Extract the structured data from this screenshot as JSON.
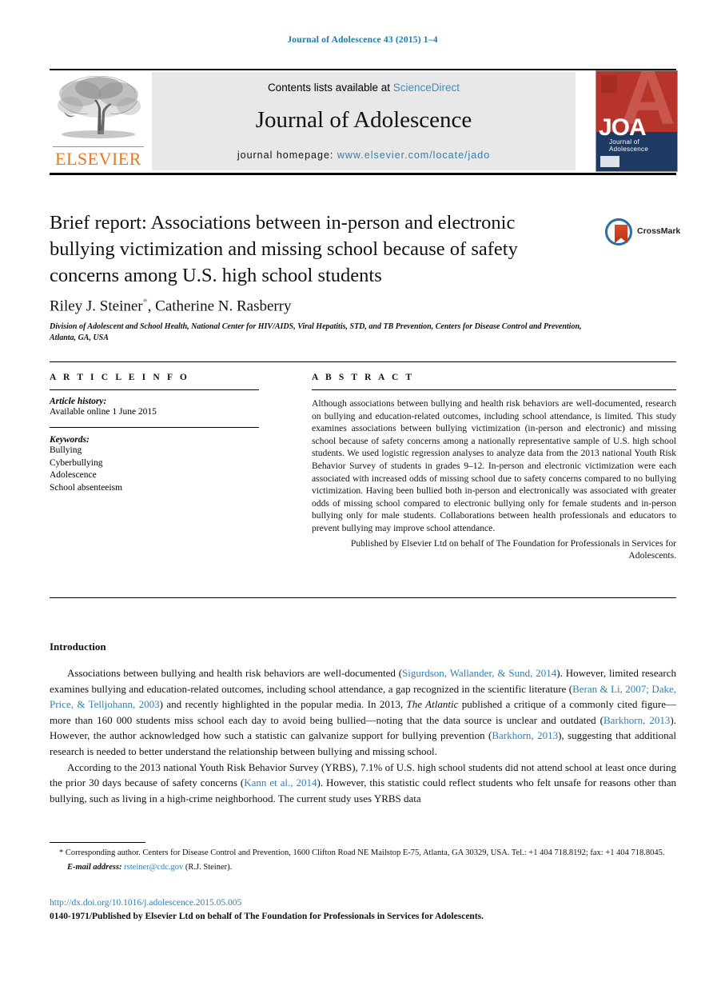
{
  "running_head": "Journal of Adolescence 43 (2015) 1–4",
  "masthead": {
    "contents_prefix": "Contents lists available at ",
    "sciencedirect": "ScienceDirect",
    "journal_name": "Journal of Adolescence",
    "homepage_prefix": "journal homepage: ",
    "homepage_url": "www.elsevier.com/locate/jado",
    "publisher_logo_text": "ELSEVIER",
    "cover": {
      "monogram": "JOA",
      "subtitle": "Journal of Adolescence",
      "letter": "A"
    },
    "link_color": "#2f7fb5",
    "panel_color": "#e8e8e8"
  },
  "article": {
    "title": "Brief report: Associations between in-person and electronic bullying victimization and missing school because of safety concerns among U.S. high school students",
    "authors": "Riley J. Steiner",
    "authors_rest": ", Catherine N. Rasberry",
    "author_marker": "*",
    "affiliation": "Division of Adolescent and School Health, National Center for HIV/AIDS, Viral Hepatitis, STD, and TB Prevention, Centers for Disease Control and Prevention, Atlanta, GA, USA",
    "crossmark_label": "CrossMark"
  },
  "info": {
    "heading": "A R T I C L E   I N F O",
    "history_label": "Article history:",
    "history_value": "Available online 1 June 2015",
    "keywords_label": "Keywords:",
    "keywords": [
      "Bullying",
      "Cyberbullying",
      "Adolescence",
      "School absenteeism"
    ]
  },
  "abstract": {
    "heading": "A B S T R A C T",
    "body": "Although associations between bullying and health risk behaviors are well-documented, research on bullying and education-related outcomes, including school attendance, is limited. This study examines associations between bullying victimization (in-person and electronic) and missing school because of safety concerns among a nationally representative sample of U.S. high school students. We used logistic regression analyses to analyze data from the 2013 national Youth Risk Behavior Survey of students in grades 9–12. In-person and electronic victimization were each associated with increased odds of missing school due to safety concerns compared to no bullying victimization. Having been bullied both in-person and electronically was associated with greater odds of missing school compared to electronic bullying only for female students and in-person bullying only for male students. Collaborations between health professionals and educators to prevent bullying may improve school attendance.",
    "published_by": "Published by Elsevier Ltd on behalf of The Foundation for Professionals in Services for Adolescents."
  },
  "body": {
    "section_title": "Introduction",
    "paragraph1": {
      "part1": "Associations between bullying and health risk behaviors are well-documented (",
      "cite1": "Sigurdson, Wallander, & Sund, 2014",
      "part2": "). However, limited research examines bullying and education-related outcomes, including school attendance, a gap recognized in the scientific literature (",
      "cite2": "Beran & Li, 2007; Dake, Price, & Telljohann, 2003",
      "part3": ") and recently highlighted in the popular media. In 2013, ",
      "italic1": "The Atlantic",
      "part4": " published a critique of a commonly cited figure—more than 160 000 students miss school each day to avoid being bullied—noting that the data source is unclear and outdated (",
      "cite3": "Barkhorn, 2013",
      "part5": "). However, the author acknowledged how such a statistic can galvanize support for bullying prevention (",
      "cite4": "Barkhorn, 2013",
      "part6": "), suggesting that additional research is needed to better understand the relationship between bullying and missing school."
    },
    "paragraph2": {
      "part1": "According to the 2013 national Youth Risk Behavior Survey (YRBS), 7.1% of U.S. high school students did not attend school at least once during the prior 30 days because of safety concerns (",
      "cite1": "Kann et al., 2014",
      "part2": "). However, this statistic could reflect students who felt unsafe for reasons other than bullying, such as living in a high-crime neighborhood. The current study uses YRBS data"
    }
  },
  "footer": {
    "corresponding_marker": "*",
    "corresponding": " Corresponding author. Centers for Disease Control and Prevention, 1600 Clifton Road NE Mailstop E-75, Atlanta, GA 30329, USA. Tel.: +1 404 718.8192; fax: +1 404 718.8045.",
    "email_label": "E-mail address:",
    "email": "rsteiner@cdc.gov",
    "email_suffix": " (R.J. Steiner).",
    "doi": "http://dx.doi.org/10.1016/j.adolescence.2015.05.005",
    "issn_line": "0140-1971/Published by Elsevier Ltd on behalf of The Foundation for Professionals in Services for Adolescents."
  }
}
